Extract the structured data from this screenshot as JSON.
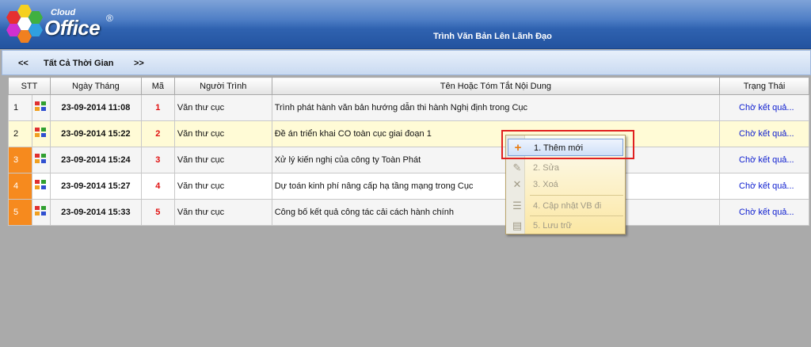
{
  "app": {
    "logo_top": "Cloud",
    "logo_main": "Office",
    "logo_reg": "®",
    "title": "Trình Văn Bản Lên Lãnh Đạo"
  },
  "filter": {
    "prev": "<<",
    "label": "Tất Cả Thời Gian",
    "next": ">>"
  },
  "grid": {
    "headers": [
      "STT",
      "Ngày Tháng",
      "Mã",
      "Người Trình",
      "Tên Hoặc Tóm Tắt Nội Dung",
      "Trạng Thái"
    ],
    "rows": [
      {
        "stt": "1",
        "date": "23-09-2014 11:08",
        "code": "1",
        "sender": "Văn thư cục",
        "content": "Trình phát hành văn bản hướng dẫn thi hành Nghị định trong Cục",
        "status": "Chờ kết quả..."
      },
      {
        "stt": "2",
        "date": "23-09-2014 15:22",
        "code": "2",
        "sender": "Văn thư cục",
        "content": "Đề án triển khai CO toàn cục giai đoạn 1",
        "status": "Chờ kết quả..."
      },
      {
        "stt": "3",
        "date": "23-09-2014 15:24",
        "code": "3",
        "sender": "Văn thư cục",
        "content": "Xử lý kiến nghị của công ty Toàn Phát",
        "status": "Chờ kết quả..."
      },
      {
        "stt": "4",
        "date": "23-09-2014 15:27",
        "code": "4",
        "sender": "Văn thư cục",
        "content": "Dự toán kinh phí nâng cấp hạ tầng mạng trong Cục",
        "status": "Chờ kết quả..."
      },
      {
        "stt": "5",
        "date": "23-09-2014 15:33",
        "code": "5",
        "sender": "Văn thư cục",
        "content": "Công bố kết quả công tác cải cách hành chính",
        "status": "Chờ kết quả..."
      }
    ]
  },
  "context_menu": {
    "items": [
      {
        "label": "1. Thêm mới",
        "icon": "plus-icon",
        "enabled": true
      },
      {
        "label": "2. Sửa",
        "icon": "edit-icon",
        "enabled": false
      },
      {
        "label": "3. Xoá",
        "icon": "delete-icon",
        "enabled": false
      },
      {
        "label": "4. Cập nhật VB đi",
        "icon": "list-icon",
        "enabled": false
      },
      {
        "label": "5. Lưu trữ",
        "icon": "archive-icon",
        "enabled": false
      }
    ]
  },
  "colors": {
    "header": "#2f62b0",
    "stt_highlight": "#f68a1e",
    "code": "#e01010",
    "status_link": "#1020d0",
    "selected_row": "#fffbd6",
    "callout": "#e02020"
  }
}
